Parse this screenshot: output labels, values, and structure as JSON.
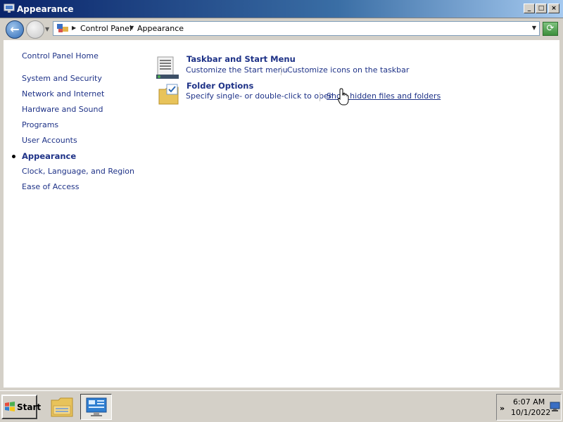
{
  "window": {
    "title": "Appearance",
    "controls": {
      "minimize": "_",
      "maximize": "□",
      "close": "×"
    }
  },
  "nav": {
    "back_icon": "←",
    "breadcrumbs": [
      "Control Panel",
      "Appearance"
    ],
    "refresh_icon": "⟳"
  },
  "sidebar": {
    "home": "Control Panel Home",
    "items": [
      "System and Security",
      "Network and Internet",
      "Hardware and Sound",
      "Programs",
      "User Accounts",
      "Appearance",
      "Clock, Language, and Region",
      "Ease of Access"
    ],
    "current_index": 5
  },
  "categories": [
    {
      "title": "Taskbar and Start Menu",
      "icon": "taskbar-icon",
      "tasks": [
        "Customize the Start menu",
        "Customize icons on the taskbar"
      ]
    },
    {
      "title": "Folder Options",
      "icon": "folder-options-icon",
      "tasks": [
        "Specify single- or double-click to open",
        "Show hidden files and folders"
      ]
    }
  ],
  "taskbar": {
    "start_label": "Start",
    "buttons": [
      "windows-explorer-icon",
      "control-panel-icon"
    ],
    "clock_time": "6:07 AM",
    "clock_date": "10/1/2022",
    "tray_expand_icon": "»"
  },
  "colors": {
    "link": "#1e3287",
    "title_gradient_start": "#0a246a",
    "taskbar_bg": "#d4d0c8"
  }
}
